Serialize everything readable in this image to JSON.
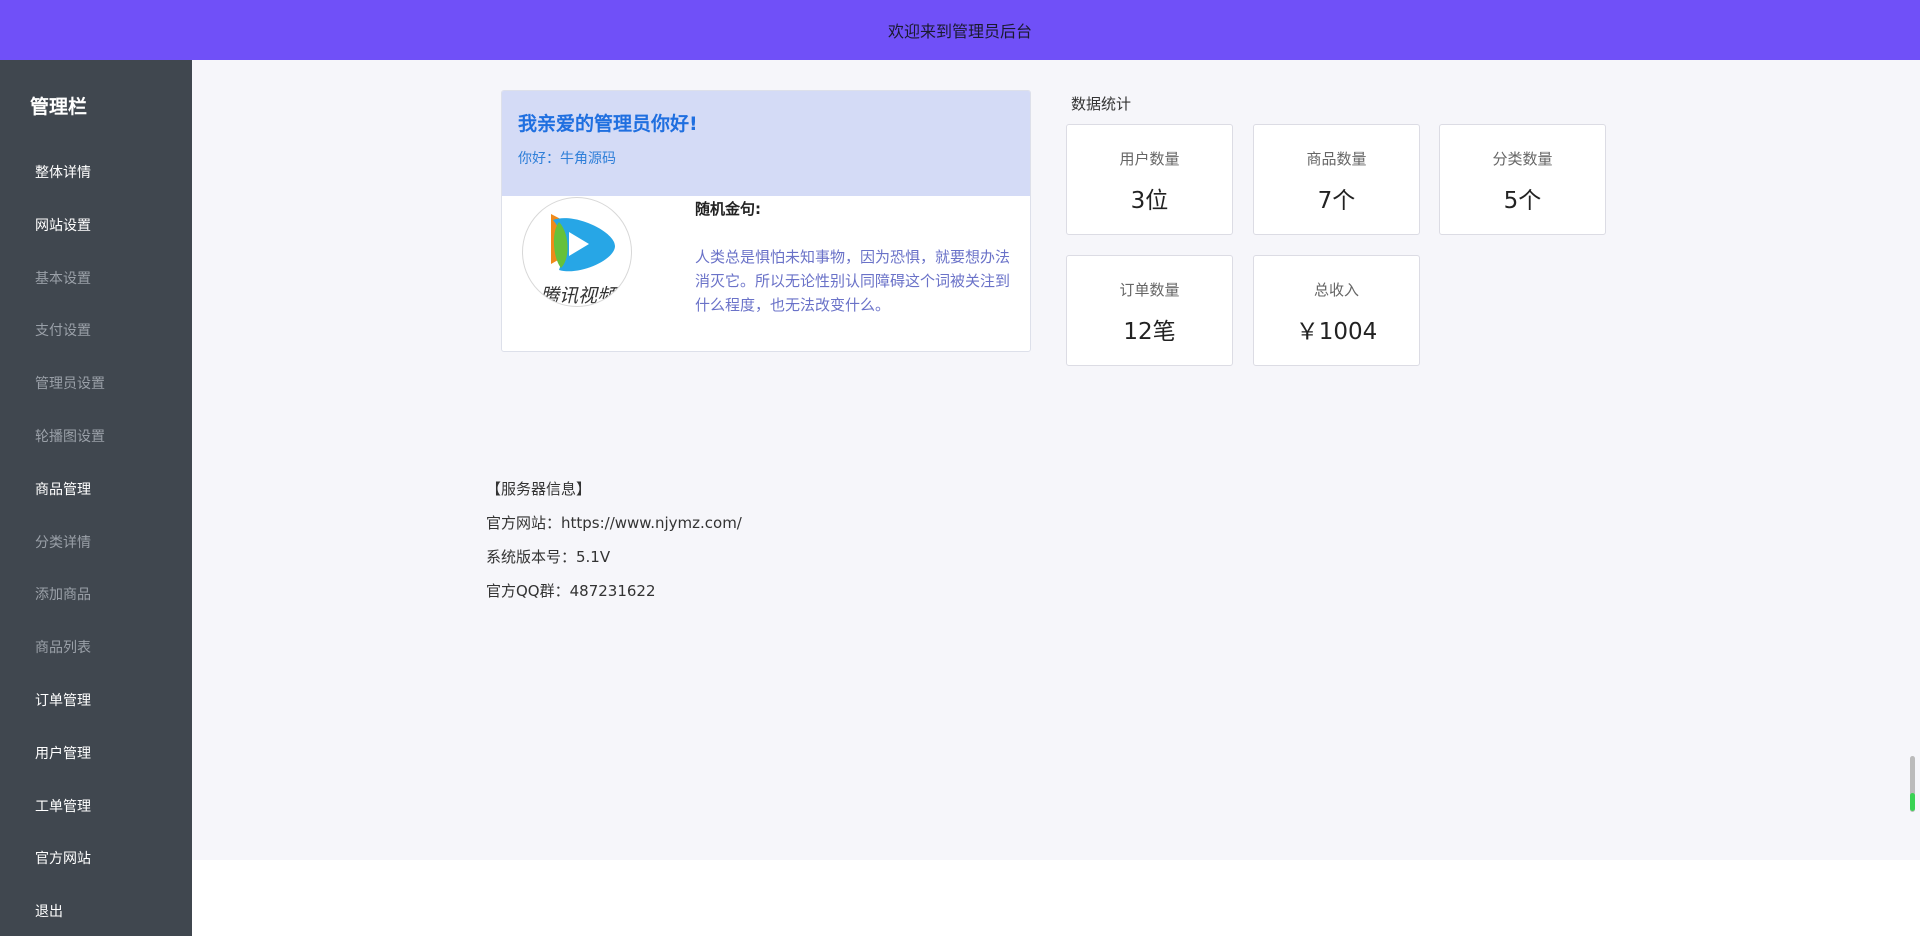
{
  "header": {
    "title": "欢迎来到管理员后台"
  },
  "sidebar": {
    "title": "管理栏",
    "items": [
      {
        "label": "整体详情",
        "sub": false
      },
      {
        "label": "网站设置",
        "sub": false
      },
      {
        "label": "基本设置",
        "sub": true
      },
      {
        "label": "支付设置",
        "sub": true
      },
      {
        "label": "管理员设置",
        "sub": true
      },
      {
        "label": "轮播图设置",
        "sub": true
      },
      {
        "label": "商品管理",
        "sub": false
      },
      {
        "label": "分类详情",
        "sub": true
      },
      {
        "label": "添加商品",
        "sub": true
      },
      {
        "label": "商品列表",
        "sub": true
      },
      {
        "label": "订单管理",
        "sub": false
      },
      {
        "label": "用户管理",
        "sub": false
      },
      {
        "label": "工单管理",
        "sub": false
      },
      {
        "label": "官方网站",
        "sub": false
      },
      {
        "label": "退出",
        "sub": false
      }
    ]
  },
  "welcome": {
    "greeting": "我亲爱的管理员你好!",
    "hello": "你好：牛角源码",
    "logo_icon": "tencent-video-logo",
    "logo_text": "腾讯视频",
    "quote_title": "随机金句:",
    "quote": "人类总是惧怕未知事物，因为恐惧，就要想办法消灭它。所以无论性别认同障碍这个词被关注到什么程度，也无法改变什么。"
  },
  "stats": {
    "label": "数据统计",
    "cards": [
      {
        "name": "用户数量",
        "value": "3位"
      },
      {
        "name": "商品数量",
        "value": "7个"
      },
      {
        "name": "分类数量",
        "value": "5个"
      },
      {
        "name": "订单数量",
        "value": "12笔"
      },
      {
        "name": "总收入",
        "value": "￥1004"
      }
    ]
  },
  "server": {
    "title": "【服务器信息】",
    "website": "官方网站：https://www.njymz.com/",
    "version": "系统版本号：5.1V",
    "qq": "官方QQ群：487231622"
  },
  "colors": {
    "header_bg": "#7050f8",
    "sidebar_bg": "#40474f",
    "greeting_blue": "#1f6fe0",
    "quote_color": "#6a72c8"
  }
}
